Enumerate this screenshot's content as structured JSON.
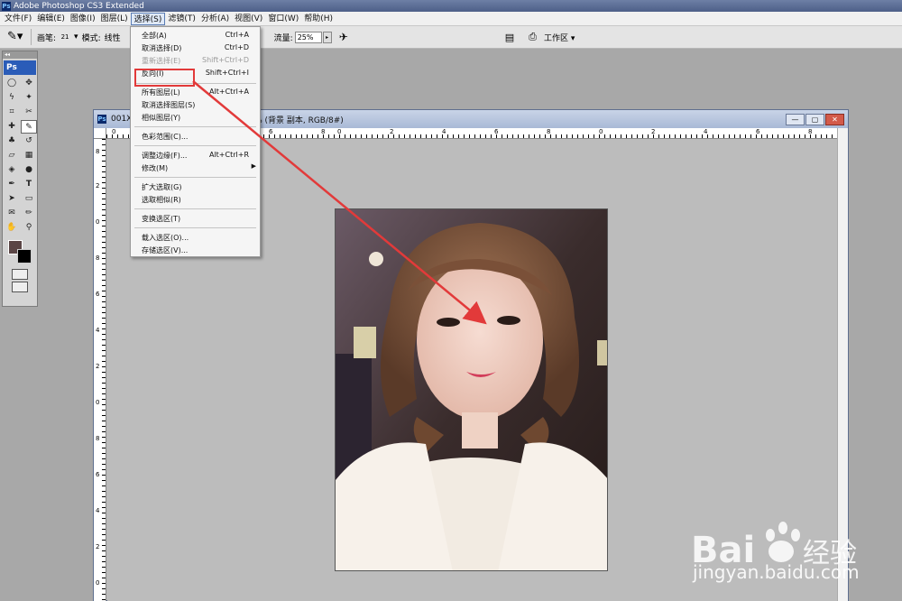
{
  "app": {
    "title": "Adobe Photoshop CS3 Extended",
    "logo_text": "Ps"
  },
  "menubar": [
    "文件(F)",
    "编辑(E)",
    "图像(I)",
    "图层(L)",
    "选择(S)",
    "滤镜(T)",
    "分析(A)",
    "视图(V)",
    "窗口(W)",
    "帮助(H)"
  ],
  "options": {
    "brush_label": "画笔:",
    "brush_size": "21",
    "mode_label": "模式:",
    "mode_value": "线性",
    "flow_label": "流量:",
    "flow_value": "25%",
    "workspace": "工作区 ▾"
  },
  "document": {
    "title_left": "001X",
    "title_right": "0% (背景 副本, RGB/8#)",
    "ruler_h": [
      "0",
      "2",
      "4",
      "6",
      "8",
      "0",
      "2",
      "4",
      "6",
      "8",
      "0",
      "2",
      "4",
      "6",
      "8"
    ],
    "ruler_v": [
      "8",
      "2",
      "0",
      "8",
      "6",
      "4",
      "2",
      "0",
      "8",
      "6",
      "4",
      "2",
      "0"
    ]
  },
  "select_menu": {
    "items": [
      {
        "label": "全部(A)",
        "shortcut": "Ctrl+A",
        "disabled": false
      },
      {
        "label": "取消选择(D)",
        "shortcut": "Ctrl+D",
        "disabled": false
      },
      {
        "label": "重新选择(E)",
        "shortcut": "Shift+Ctrl+D",
        "disabled": true
      },
      {
        "label": "反向(I)",
        "shortcut": "Shift+Ctrl+I",
        "disabled": false
      },
      {
        "label": "所有图层(L)",
        "shortcut": "Alt+Ctrl+A",
        "disabled": false
      },
      {
        "label": "取消选择图层(S)",
        "shortcut": "",
        "disabled": false
      },
      {
        "label": "相似图层(Y)",
        "shortcut": "",
        "disabled": false
      },
      {
        "label": "色彩范围(C)...",
        "shortcut": "",
        "disabled": false
      },
      {
        "label": "调整边缘(F)...",
        "shortcut": "Alt+Ctrl+R",
        "disabled": false
      },
      {
        "label": "修改(M)",
        "shortcut": "",
        "disabled": false,
        "submenu": true
      },
      {
        "label": "扩大选取(G)",
        "shortcut": "",
        "disabled": false
      },
      {
        "label": "选取相似(R)",
        "shortcut": "",
        "disabled": false
      },
      {
        "label": "变换选区(T)",
        "shortcut": "",
        "disabled": false
      },
      {
        "label": "载入选区(O)...",
        "shortcut": "",
        "disabled": false
      },
      {
        "label": "存储选区(V)...",
        "shortcut": "",
        "disabled": false
      }
    ]
  },
  "watermark": {
    "brand": "Bai 经验",
    "url": "jingyan.baidu.com"
  },
  "colors": {
    "accent_red": "#e23a3a",
    "foreground": "#5a4545",
    "background": "#000000"
  }
}
